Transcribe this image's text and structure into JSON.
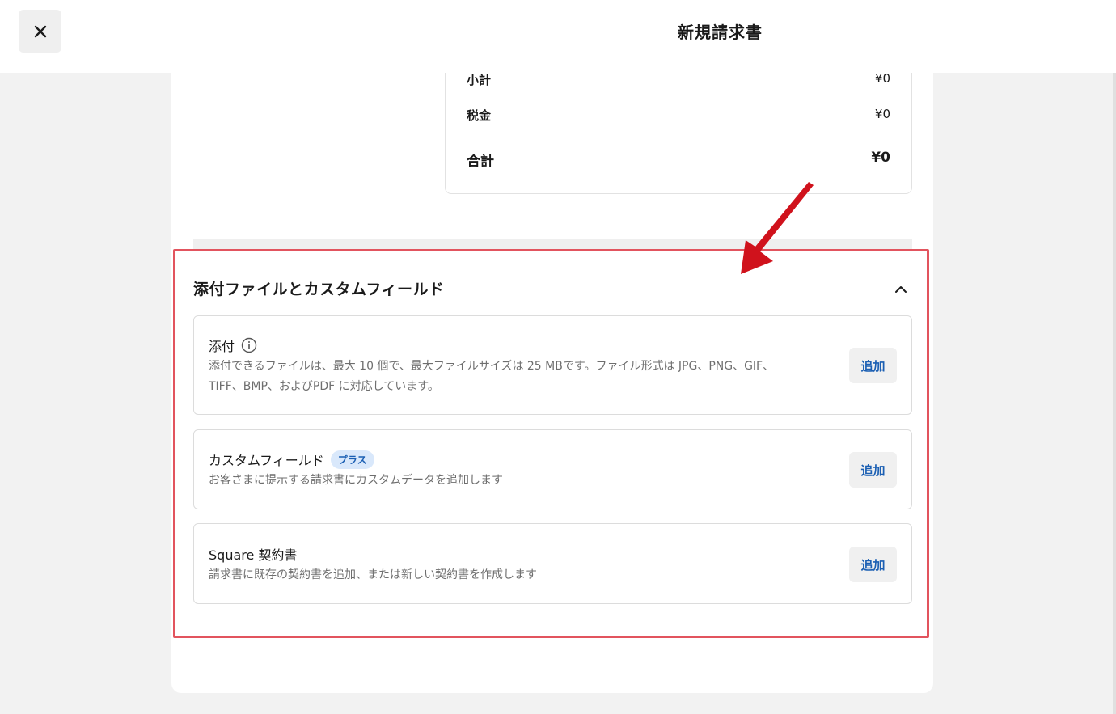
{
  "header": {
    "title": "新規請求書",
    "close_icon": "close-icon"
  },
  "totals": {
    "subtotal_label": "小計",
    "subtotal_value": "¥0",
    "tax_label": "税金",
    "tax_value": "¥0",
    "total_label": "合計",
    "total_value": "¥0"
  },
  "section": {
    "title": "添付ファイルとカスタムフィールド",
    "collapse_icon": "chevron-up-icon",
    "highlight_color": "#e2545e"
  },
  "cards": {
    "attachment": {
      "title": "添付",
      "info_icon": "info-icon",
      "desc_line1": "添付できるファイルは、最大 10 個で、最大ファイルサイズは 25 MBです。ファイル形式は JPG、PNG、GIF、",
      "desc_line2": "TIFF、BMP、およびPDF に対応しています。",
      "button": "追加"
    },
    "custom_fields": {
      "title": "カスタムフィールド",
      "badge": "プラス",
      "desc": "お客さまに提示する請求書にカスタムデータを追加します",
      "button": "追加"
    },
    "contract": {
      "title": "Square 契約書",
      "desc": "請求書に既存の契約書を追加、または新しい契約書を作成します",
      "button": "追加"
    }
  },
  "colors": {
    "accent": "#1b5fb3",
    "arrow": "#d0121c"
  }
}
